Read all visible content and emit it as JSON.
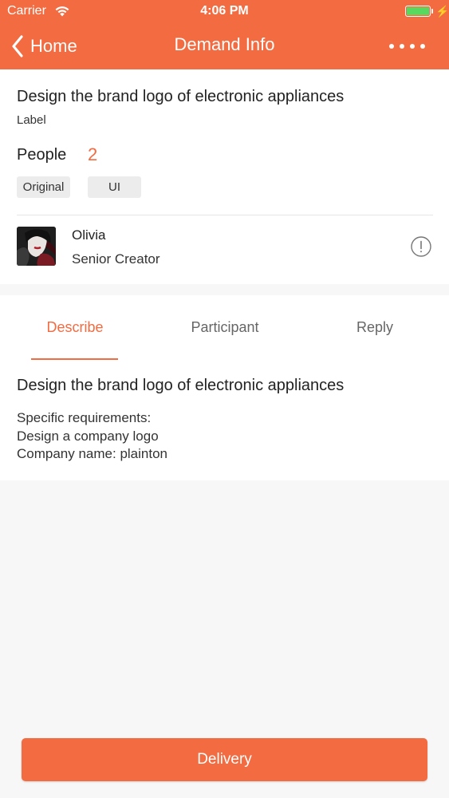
{
  "status_bar": {
    "carrier": "Carrier",
    "time": "4:06 PM",
    "battery_level": 1.0
  },
  "nav": {
    "back_label": "Home",
    "title": "Demand Info",
    "more_icon": "more-dots-icon",
    "back_icon": "chevron-left-icon"
  },
  "demand": {
    "title": "Design the brand logo of electronic appliances",
    "label": "Label",
    "people_label": "People",
    "people_count": "2",
    "tags": [
      "Original",
      "UI"
    ]
  },
  "user": {
    "name": "Olivia",
    "role": "Senior Creator",
    "info_icon": "info-circle-icon"
  },
  "tabs": [
    {
      "label": "Describe",
      "active": true
    },
    {
      "label": "Participant",
      "active": false
    },
    {
      "label": "Reply",
      "active": false
    }
  ],
  "description": {
    "title": "Design the brand logo of electronic appliances",
    "lines": [
      "Specific requirements:",
      "Design a company logo",
      "Company name: plainton"
    ]
  },
  "footer": {
    "button_label": "Delivery"
  },
  "colors": {
    "accent": "#f26b41",
    "battery": "#59d860",
    "background": "#f7f7f7"
  }
}
